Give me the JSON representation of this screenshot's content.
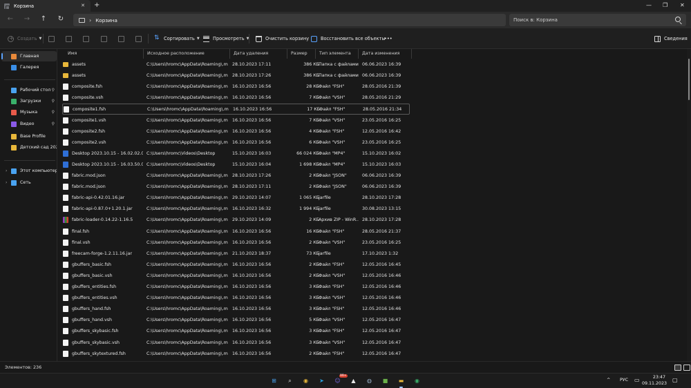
{
  "window": {
    "tab_title": "Корзина",
    "tab_close": "✕",
    "new_tab": "+",
    "minimize": "—",
    "maximize": "❐",
    "close": "✕"
  },
  "nav": {
    "back": "←",
    "forward": "→",
    "up": "↑",
    "refresh": "↻",
    "path_sep": "›",
    "path": "Корзина",
    "search_placeholder": "Поиск в: Корзина"
  },
  "toolbar": {
    "create": "Создать",
    "sort": "Сортировать",
    "view": "Просмотреть",
    "empty_bin": "Очистить корзину",
    "restore_all": "Восстановить все объекты",
    "more": "•••",
    "details": "Сведения"
  },
  "sidebar": {
    "items": [
      {
        "label": "Главная",
        "color": "#e8893a"
      },
      {
        "label": "Галерея",
        "color": "#3a8fe8"
      },
      {
        "label": "Рабочий стол",
        "color": "#4aa3f0",
        "pin": "📌"
      },
      {
        "label": "Загрузки",
        "color": "#3ab06a",
        "pin": "📌"
      },
      {
        "label": "Музыка",
        "color": "#e85a4a",
        "pin": "📌"
      },
      {
        "label": "Видео",
        "color": "#8a5ae8",
        "pin": "📌"
      },
      {
        "label": "Base Profile",
        "color": "#e8b73a"
      },
      {
        "label": "Детский сад 2023г",
        "color": "#e8b73a"
      },
      {
        "label": "Этот компьютер",
        "color": "#4aa3f0",
        "chevron": "›"
      },
      {
        "label": "Сеть",
        "color": "#4aa3f0",
        "chevron": "›"
      }
    ]
  },
  "columns": [
    "Имя",
    "Исходное расположение",
    "Дата удаления",
    "Размер",
    "Тип элемента",
    "Дата изменения"
  ],
  "sort_arrow": "^",
  "files": [
    {
      "name": "assets",
      "icon": "folder",
      "orig": "C:\\Users\\hromc\\AppData\\Roaming\\.minc...",
      "deleted": "28.10.2023 17:11",
      "size": "386 КБ",
      "type": "Папка с файлами",
      "modified": "06.06.2023 16:39"
    },
    {
      "name": "assets",
      "icon": "folder",
      "orig": "C:\\Users\\hromc\\AppData\\Roaming\\.minc...",
      "deleted": "28.10.2023 17:26",
      "size": "386 КБ",
      "type": "Папка с файлами",
      "modified": "06.06.2023 16:39"
    },
    {
      "name": "composite.fsh",
      "icon": "file",
      "orig": "C:\\Users\\hromc\\AppData\\Roaming\\.minc...",
      "deleted": "16.10.2023 16:56",
      "size": "28 КБ",
      "type": "Файл \"FSH\"",
      "modified": "28.05.2016 21:39"
    },
    {
      "name": "composite.vsh",
      "icon": "file",
      "orig": "C:\\Users\\hromc\\AppData\\Roaming\\.minc...",
      "deleted": "16.10.2023 16:56",
      "size": "7 КБ",
      "type": "Файл \"VSH\"",
      "modified": "28.05.2016 21:29"
    },
    {
      "name": "composite1.fsh",
      "icon": "file",
      "orig": "C:\\Users\\hromc\\AppData\\Roaming\\.minc...",
      "deleted": "16.10.2023 16:56",
      "size": "17 КБ",
      "type": "Файл \"FSH\"",
      "modified": "28.05.2016 21:34"
    },
    {
      "name": "composite1.vsh",
      "icon": "file",
      "orig": "C:\\Users\\hromc\\AppData\\Roaming\\.minc...",
      "deleted": "16.10.2023 16:56",
      "size": "7 КБ",
      "type": "Файл \"VSH\"",
      "modified": "23.05.2016 16:25"
    },
    {
      "name": "composite2.fsh",
      "icon": "file",
      "orig": "C:\\Users\\hromc\\AppData\\Roaming\\.minc...",
      "deleted": "16.10.2023 16:56",
      "size": "4 КБ",
      "type": "Файл \"FSH\"",
      "modified": "12.05.2016 16:42"
    },
    {
      "name": "composite2.vsh",
      "icon": "file",
      "orig": "C:\\Users\\hromc\\AppData\\Roaming\\.minc...",
      "deleted": "16.10.2023 16:56",
      "size": "6 КБ",
      "type": "Файл \"VSH\"",
      "modified": "23.05.2016 16:25"
    },
    {
      "name": "Desktop 2023.10.15 - 16.02.02.01",
      "icon": "video",
      "orig": "C:\\Users\\hromc\\Videos\\Desktop",
      "deleted": "15.10.2023 16:03",
      "size": "66 024 КБ",
      "type": "Файл \"MP4\"",
      "modified": "15.10.2023 16:02"
    },
    {
      "name": "Desktop 2023.10.15 - 16.03.50.02",
      "icon": "video",
      "orig": "C:\\Users\\hromc\\Videos\\Desktop",
      "deleted": "15.10.2023 16:04",
      "size": "1 698 КБ",
      "type": "Файл \"MP4\"",
      "modified": "15.10.2023 16:03"
    },
    {
      "name": "fabric.mod.json",
      "icon": "file",
      "orig": "C:\\Users\\hromc\\AppData\\Roaming\\.minc...",
      "deleted": "28.10.2023 17:26",
      "size": "2 КБ",
      "type": "Файл \"JSON\"",
      "modified": "06.06.2023 16:39"
    },
    {
      "name": "fabric.mod.json",
      "icon": "file",
      "orig": "C:\\Users\\hromc\\AppData\\Roaming\\.minc...",
      "deleted": "28.10.2023 17:11",
      "size": "2 КБ",
      "type": "Файл \"JSON\"",
      "modified": "06.06.2023 16:39"
    },
    {
      "name": "fabric-api-0.42.01.16.jar",
      "icon": "file",
      "orig": "C:\\Users\\hromc\\AppData\\Roaming\\.minc...",
      "deleted": "29.10.2023 14:07",
      "size": "1 065 КБ",
      "type": "jarfile",
      "modified": "28.10.2023 17:28"
    },
    {
      "name": "fabric-api-0.87.0+1.20.1.jar",
      "icon": "file",
      "orig": "C:\\Users\\hromc\\AppData\\Roaming\\.minc...",
      "deleted": "16.10.2023 16:32",
      "size": "1 994 КБ",
      "type": "jarfile",
      "modified": "30.08.2023 13:15"
    },
    {
      "name": "fabric-loader-0.14.22-1.16.5",
      "icon": "winrar",
      "orig": "C:\\Users\\hromc\\AppData\\Roaming\\.minc...",
      "deleted": "29.10.2023 14:09",
      "size": "2 КБ",
      "type": "Архив ZIP - WinR...",
      "modified": "28.10.2023 17:28"
    },
    {
      "name": "final.fsh",
      "icon": "file",
      "orig": "C:\\Users\\hromc\\AppData\\Roaming\\.minc...",
      "deleted": "16.10.2023 16:56",
      "size": "16 КБ",
      "type": "Файл \"FSH\"",
      "modified": "28.05.2016 21:37"
    },
    {
      "name": "final.vsh",
      "icon": "file",
      "orig": "C:\\Users\\hromc\\AppData\\Roaming\\.minc...",
      "deleted": "16.10.2023 16:56",
      "size": "2 КБ",
      "type": "Файл \"VSH\"",
      "modified": "23.05.2016 16:25"
    },
    {
      "name": "freecam-forge-1.2.11.16.jar",
      "icon": "file",
      "orig": "C:\\Users\\hromc\\AppData\\Roaming\\.minc...",
      "deleted": "21.10.2023 18:37",
      "size": "73 КБ",
      "type": "jarfile",
      "modified": "17.10.2023 1:32"
    },
    {
      "name": "gbuffers_basic.fsh",
      "icon": "file",
      "orig": "C:\\Users\\hromc\\AppData\\Roaming\\.minc...",
      "deleted": "16.10.2023 16:56",
      "size": "2 КБ",
      "type": "Файл \"FSH\"",
      "modified": "12.05.2016 16:45"
    },
    {
      "name": "gbuffers_basic.vsh",
      "icon": "file",
      "orig": "C:\\Users\\hromc\\AppData\\Roaming\\.minc...",
      "deleted": "16.10.2023 16:56",
      "size": "2 КБ",
      "type": "Файл \"VSH\"",
      "modified": "12.05.2016 16:46"
    },
    {
      "name": "gbuffers_entities.fsh",
      "icon": "file",
      "orig": "C:\\Users\\hromc\\AppData\\Roaming\\.minc...",
      "deleted": "16.10.2023 16:56",
      "size": "3 КБ",
      "type": "Файл \"FSH\"",
      "modified": "12.05.2016 16:46"
    },
    {
      "name": "gbuffers_entities.vsh",
      "icon": "file",
      "orig": "C:\\Users\\hromc\\AppData\\Roaming\\.minc...",
      "deleted": "16.10.2023 16:56",
      "size": "3 КБ",
      "type": "Файл \"VSH\"",
      "modified": "12.05.2016 16:46"
    },
    {
      "name": "gbuffers_hand.fsh",
      "icon": "file",
      "orig": "C:\\Users\\hromc\\AppData\\Roaming\\.minc...",
      "deleted": "16.10.2023 16:56",
      "size": "3 КБ",
      "type": "Файл \"FSH\"",
      "modified": "12.05.2016 16:46"
    },
    {
      "name": "gbuffers_hand.vsh",
      "icon": "file",
      "orig": "C:\\Users\\hromc\\AppData\\Roaming\\.minc...",
      "deleted": "16.10.2023 16:56",
      "size": "5 КБ",
      "type": "Файл \"VSH\"",
      "modified": "12.05.2016 16:47"
    },
    {
      "name": "gbuffers_skybasic.fsh",
      "icon": "file",
      "orig": "C:\\Users\\hromc\\AppData\\Roaming\\.minc...",
      "deleted": "16.10.2023 16:56",
      "size": "3 КБ",
      "type": "Файл \"FSH\"",
      "modified": "12.05.2016 16:47"
    },
    {
      "name": "gbuffers_skybasic.vsh",
      "icon": "file",
      "orig": "C:\\Users\\hromc\\AppData\\Roaming\\.minc...",
      "deleted": "16.10.2023 16:56",
      "size": "3 КБ",
      "type": "Файл \"VSH\"",
      "modified": "12.05.2016 16:47"
    },
    {
      "name": "gbuffers_skytextured.fsh",
      "icon": "file",
      "orig": "C:\\Users\\hromc\\AppData\\Roaming\\.minc...",
      "deleted": "16.10.2023 16:56",
      "size": "2 КБ",
      "type": "Файл \"FSH\"",
      "modified": "12.05.2016 16:47"
    }
  ],
  "status": {
    "items_count": "Элементов: 236"
  },
  "taskbar": {
    "apps": [
      {
        "name": "start",
        "glyph": "⊞",
        "color": "#4aa3f0"
      },
      {
        "name": "search",
        "glyph": "⌕",
        "color": "#e8e8e8"
      },
      {
        "name": "chrome",
        "glyph": "◉",
        "color": "#e8b73a"
      },
      {
        "name": "telegram",
        "glyph": "➤",
        "color": "#2aa3e0"
      },
      {
        "name": "discord",
        "glyph": "☺",
        "color": "#7a6ae8",
        "badge": "99+"
      },
      {
        "name": "minecraft-launcher",
        "glyph": "▲",
        "color": "#e8e8e8"
      },
      {
        "name": "steam",
        "glyph": "◍",
        "color": "#9ab0c8"
      },
      {
        "name": "minecraft",
        "glyph": "■",
        "color": "#6ab04a"
      },
      {
        "name": "file-explorer",
        "glyph": "▬",
        "color": "#e8b73a",
        "active": true
      },
      {
        "name": "chrome-profile",
        "glyph": "◉",
        "color": "#3ab06a"
      }
    ],
    "tray_arrow": "^",
    "language": "РУС",
    "time": "23:47",
    "date": "09.11.2023"
  }
}
